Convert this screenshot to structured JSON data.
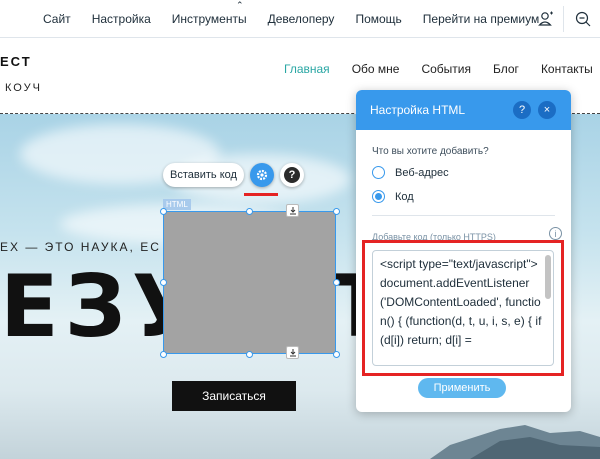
{
  "topbar": {
    "menu": [
      "Сайт",
      "Настройка",
      "Инструменты",
      "Девелоперу",
      "Помощь",
      "Перейти на премиум"
    ],
    "caret_icon": "chevron-up-icon",
    "right_icons": [
      "user-icon",
      "zoom-out-icon"
    ]
  },
  "site": {
    "brand": "ЕСТ",
    "brand_sub": "КОУЧ",
    "nav": [
      "Главная",
      "Обо мне",
      "События",
      "Блог",
      "Контакты"
    ],
    "active_nav": "Главная",
    "accent": "#2aa7a4"
  },
  "hero": {
    "line": "ЕХ — ЭТО НАУКА, ЕС",
    "big": "ЕЗУ",
    "big_tail": "Т",
    "cta": "Записаться"
  },
  "element_toolbar": {
    "insert_code": "Вставить код",
    "settings_icon": "gear-icon",
    "help": "?",
    "html_tag": "HTML"
  },
  "panel": {
    "title": "Настройка HTML",
    "help": "?",
    "close": "×",
    "question": "Что вы хотите добавить?",
    "options": [
      "Веб-адрес",
      "Код"
    ],
    "selected_option": "Код",
    "code_label": "Добавьте код (только HTTPS)",
    "code_value": "<script type=\"text/javascript\">document.addEventListener('DOMContentLoaded', function() { (function(d, t, u, i, s, e) { if (d[i]) return; d[i] =",
    "apply": "Применить",
    "accent": "#3899ec",
    "highlight": "#e52323"
  }
}
